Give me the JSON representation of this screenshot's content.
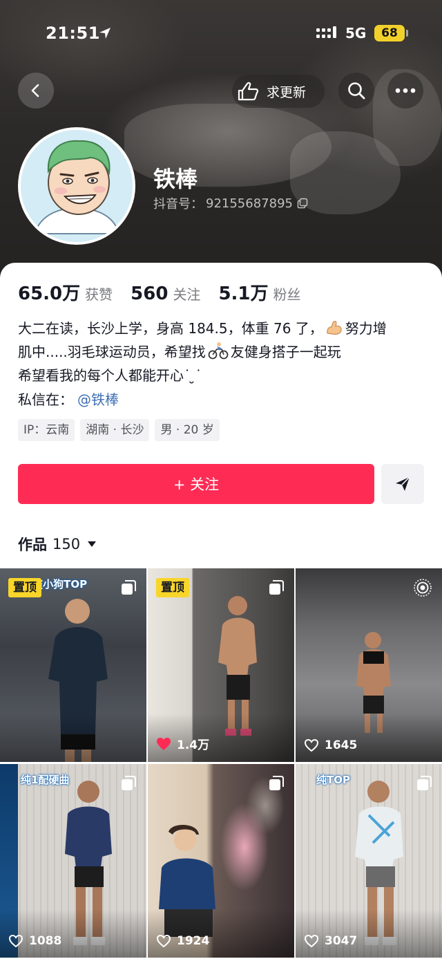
{
  "status_bar": {
    "time": "21:51",
    "network": "5G",
    "battery": "68"
  },
  "header": {
    "request_update_label": "求更新"
  },
  "profile": {
    "nickname": "铁棒",
    "id_label": "抖音号：",
    "id_value": "92155687895"
  },
  "stats": [
    {
      "value": "65.0万",
      "label": "获赞"
    },
    {
      "value": "560",
      "label": "关注"
    },
    {
      "value": "5.1万",
      "label": "粉丝"
    }
  ],
  "bio": {
    "line1_a": "大二在读，长沙上学，身高 184.5，体重 76 了，",
    "line1_b": "努力增",
    "line2_a": "肌中.....羽毛球运动员，希望找",
    "line2_b": "友健身搭子一起玩",
    "line3": "希望看我的每个人都能开心˙ ̮˙",
    "contact_label": "私信在：",
    "contact_mention": "@铁棒"
  },
  "tags": [
    "IP：云南",
    "湖南 · 长沙",
    "男 · 20 岁"
  ],
  "actions": {
    "follow_label": "+ 关注"
  },
  "works": {
    "label": "作品",
    "count": "150"
  },
  "grid": [
    {
      "pinned": "置顶",
      "stamp": "...爽小狗TOP",
      "likes": "",
      "liked": false
    },
    {
      "pinned": "置顶",
      "stamp": "",
      "likes": "1.4万",
      "liked": true
    },
    {
      "pinned": "",
      "stamp": "",
      "likes": "1645",
      "liked": false
    },
    {
      "pinned": "",
      "stamp": "纯1配硬曲",
      "likes": "1088",
      "liked": false
    },
    {
      "pinned": "",
      "stamp": "",
      "likes": "1924",
      "liked": false
    },
    {
      "pinned": "",
      "stamp": "纯TOP",
      "likes": "3047",
      "liked": false
    }
  ],
  "colors": {
    "accent": "#fe2c55",
    "pin": "#f8d52a",
    "mention": "#3e6fb4"
  },
  "icons": [
    "back-arrow-icon",
    "hand-pointer-icon",
    "search-icon",
    "more-dots-icon",
    "copy-icon",
    "share-arrow-icon",
    "heart-icon",
    "multi-image-icon",
    "live-photo-icon"
  ]
}
